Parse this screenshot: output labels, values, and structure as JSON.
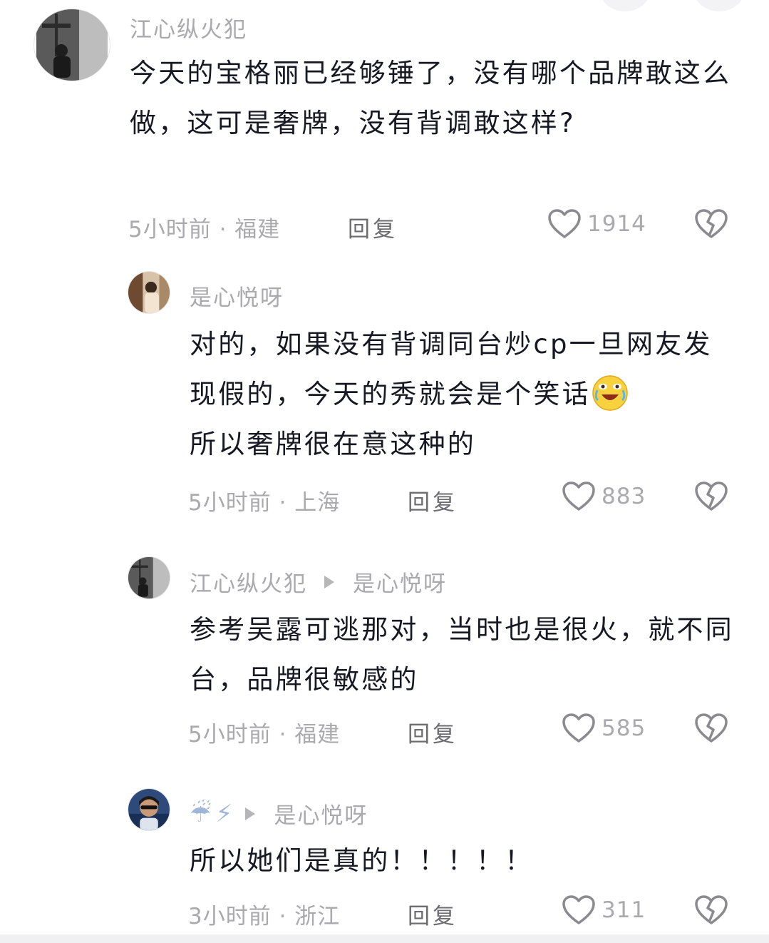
{
  "comments": [
    {
      "user": "江心纵火犯",
      "text": "今天的宝格丽已经够锤了，没有哪个品牌敢这么做，这可是奢牌，没有背调敢这样?",
      "time": "5小时前 · 福建",
      "reply": "回复",
      "likes": "1914"
    },
    {
      "user": "是心悦呀",
      "text_before": "对的，如果没有背调同台炒cp一旦网友发现假的，今天的秀就会是个笑话",
      "text_after": "所以奢牌很在意这种的",
      "time": "5小时前 · 上海",
      "reply": "回复",
      "likes": "883"
    },
    {
      "user": "江心纵火犯",
      "reply_to": "是心悦呀",
      "text": "参考吴露可逃那对，当时也是很火，就不同台，品牌很敏感的",
      "time": "5小时前 · 福建",
      "reply": "回复",
      "likes": "585"
    },
    {
      "user": "☔⚡",
      "reply_to": "是心悦呀",
      "text": "所以她们是真的！！！！！",
      "time": "3小时前 · 浙江",
      "reply": "回复",
      "likes": "311"
    }
  ]
}
